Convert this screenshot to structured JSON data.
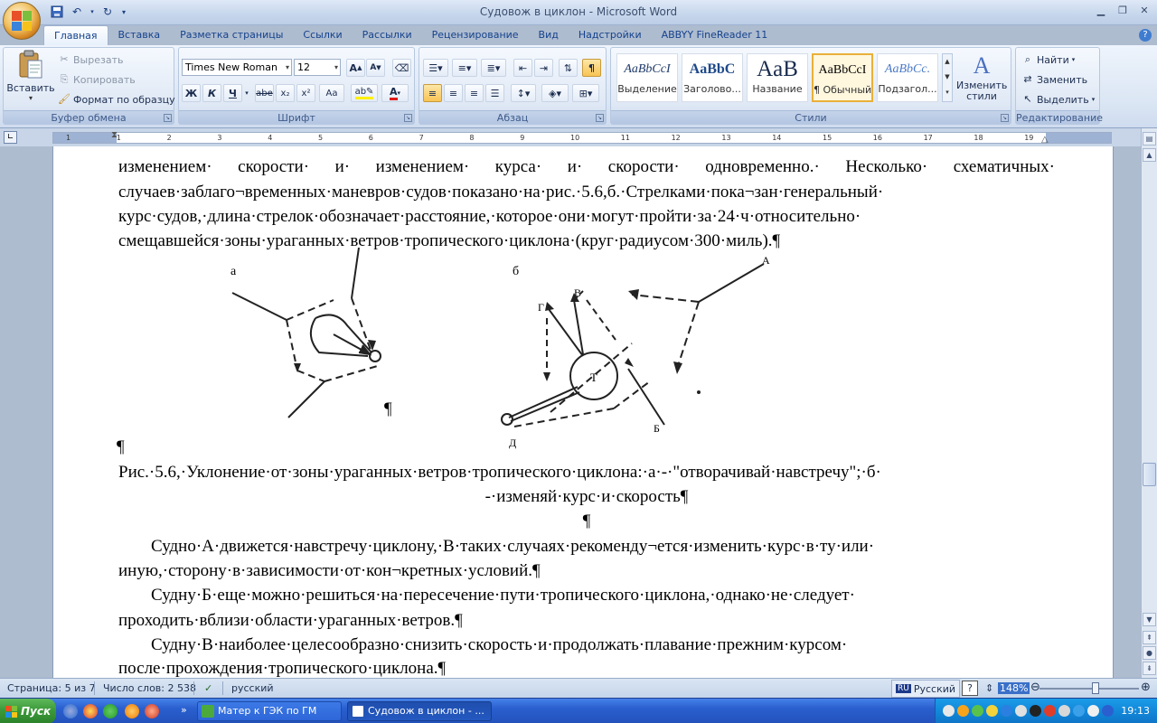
{
  "window": {
    "title": "Судовож в циклон - Microsoft Word"
  },
  "tabs": [
    "Главная",
    "Вставка",
    "Разметка страницы",
    "Ссылки",
    "Рассылки",
    "Рецензирование",
    "Вид",
    "Надстройки",
    "ABBYY FineReader 11"
  ],
  "clipboard": {
    "paste": "Вставить",
    "cut": "Вырезать",
    "copy": "Копировать",
    "format_painter": "Формат по образцу",
    "label": "Буфер обмена"
  },
  "font": {
    "name": "Times New Roman",
    "size": "12",
    "label": "Шрифт",
    "bold": "Ж",
    "italic": "К",
    "underline": "Ч",
    "strike": "abe",
    "sub": "x₂",
    "sup": "x²",
    "case": "Aa"
  },
  "paragraph": {
    "label": "Абзац",
    "pilcrow": "¶"
  },
  "styles": {
    "label": "Стили",
    "items": [
      {
        "sample": "AaBbCcI",
        "name": "Выделение"
      },
      {
        "sample": "AaBbC",
        "name": "Заголово..."
      },
      {
        "sample": "AaB",
        "name": "Название"
      },
      {
        "sample": "AaBbCcI",
        "name": "¶ Обычный"
      },
      {
        "sample": "AaBbCc.",
        "name": "Подзагол..."
      }
    ],
    "change": "Изменить стили"
  },
  "editing": {
    "label": "Редактирование",
    "find": "Найти",
    "replace": "Заменить",
    "select": "Выделить"
  },
  "ruler": {
    "ticks": [
      "1",
      "1",
      "2",
      "3",
      "4",
      "5",
      "6",
      "7",
      "8",
      "9",
      "10",
      "11",
      "12",
      "13",
      "14",
      "15",
      "16",
      "17",
      "18",
      "19"
    ]
  },
  "document": {
    "lines": [
      "изменением· скорости· и· изменением· курса· и· скорости· одновременно.· Несколько· схематичных·",
      "случаев·заблаго¬временных·маневров·судов·показано·на·рис.·5.6,б.·Стрелками·пока¬зан·генеральный·",
      "курс·судов,·длина·стрелок·обозначает·расстояние,·которое·они·могут·пройти·за·24·ч·относительно·",
      "смещавшейся·зоны·ураганных·ветров·тропического·циклона·(круг·радиусом·300·миль).¶"
    ],
    "fig_a_label": "а",
    "fig_b_label": "б",
    "fig_b_letters": {
      "A": "А",
      "B": "Б",
      "V": "В",
      "G": "Г",
      "D": "Д",
      "T": "Т"
    },
    "pilcrow_after_fig": "¶",
    "pilcrow_left": "¶",
    "caption1": "Рис.·5.6,·Уклонение·от·зоны·ураганных·ветров·тропического·циклона:·а·-·\"отворачивай·навстречу\";·б·",
    "caption2": "-·изменяй·курс·и·скорость¶",
    "empty": "¶",
    "para1a": "Судно·А·движется·навстречу·циклону,·В·таких·случаях·рекоменду¬ется·изменить·курс·в·ту·или·",
    "para1b": "иную,·сторону·в·зависимости·от·кон¬кретных·условий.¶",
    "para2a": "Судну·Б·еще·можно·решиться·на·пересечение·пути·тропического·циклона,·однако·не·следует·",
    "para2b": "проходить·вблизи·области·ураганных·ветров.¶",
    "para3a": "Судну·В·наиболее·целесообразно·снизить·скорость·и·продолжать·плавание·прежним·курсом·",
    "para3b": "после·прохождения·тропического·циклона.¶"
  },
  "status": {
    "page": "Страница: 5 из 7",
    "words": "Число слов: 2 538",
    "lang": "русский",
    "kbd_lang": "Русский",
    "kbd_code": "RU",
    "zoom": "148%"
  },
  "taskbar": {
    "start": "Пуск",
    "items": [
      {
        "label": "Матер к ГЭК по ГМ"
      },
      {
        "label": "Судовож в циклон - ..."
      }
    ],
    "clock": "19:13"
  }
}
